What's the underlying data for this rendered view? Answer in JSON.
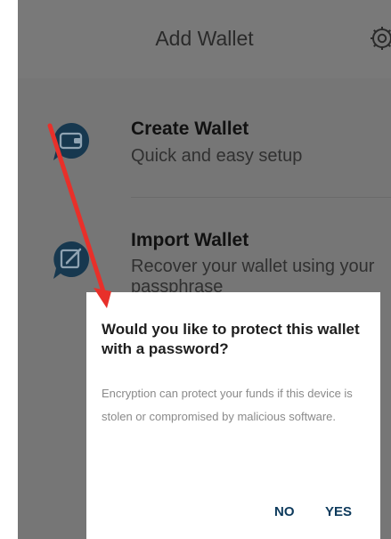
{
  "header": {
    "title": "Add Wallet",
    "settings_icon": "gear-icon"
  },
  "menu": {
    "items": [
      {
        "title": "Create Wallet",
        "subtitle": "Quick and easy setup",
        "icon": "wallet-icon"
      },
      {
        "title": "Import Wallet",
        "subtitle_line1": "Recover your wallet using your",
        "subtitle_line2": "passphrase",
        "icon": "edit-icon"
      }
    ]
  },
  "dialog": {
    "title": "Would you like to protect this wallet with a password?",
    "body": "Encryption can protect your funds if this device is stolen or compromised by malicious software.",
    "no_label": "NO",
    "yes_label": "YES"
  },
  "colors": {
    "overlay_bg": "#767676",
    "icon_blue": "#17384f",
    "button_text": "#0d3a5c",
    "annotation_arrow": "#e8302a"
  }
}
